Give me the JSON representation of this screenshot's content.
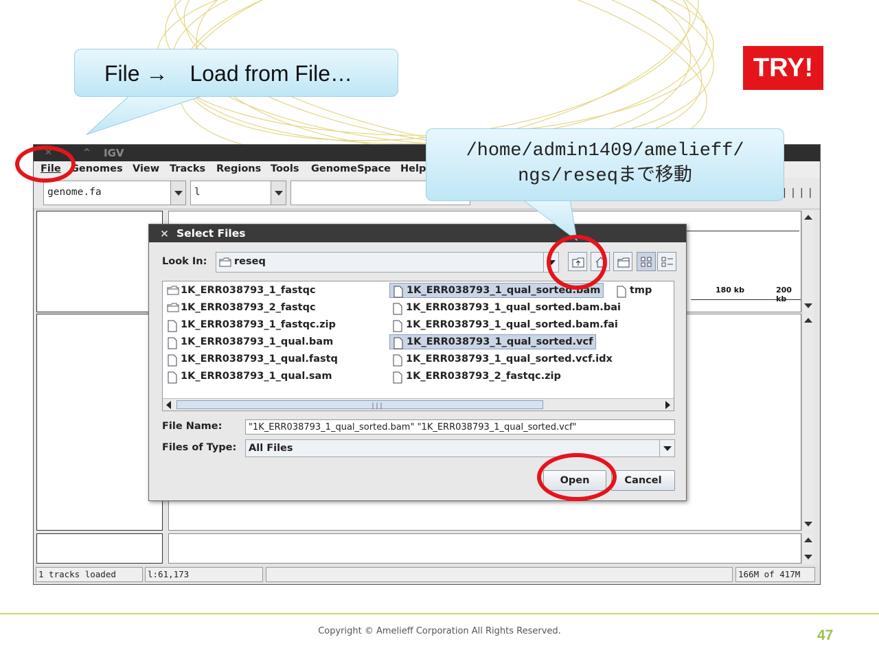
{
  "callout_top": {
    "text": "File →　Load from File…"
  },
  "callout_path": {
    "line1": "/home/admin1409/amelieff/",
    "line2": "ngs/reseqまで移動"
  },
  "badge": {
    "text": "TRY!"
  },
  "igv": {
    "title": "IGV",
    "menu": [
      "File",
      "Genomes",
      "View",
      "Tracks",
      "Regions",
      "Tools",
      "GenomeSpace",
      "Help"
    ],
    "genome_value": "genome.fa",
    "chrom_value": "l",
    "ruler_labels": [
      "180 kb",
      "200 kb"
    ],
    "status": {
      "tracks": "1 tracks loaded",
      "position": "l:61,173",
      "memory": "166M of 417M"
    }
  },
  "dialog": {
    "title": "Select Files",
    "look_in_label": "Look In:",
    "look_in_value": "reseq",
    "files": [
      {
        "name": "1K_ERR038793_1_fastqc",
        "kind": "folder",
        "selected": false
      },
      {
        "name": "1K_ERR038793_2_fastqc",
        "kind": "folder",
        "selected": false
      },
      {
        "name": "1K_ERR038793_1_fastqc.zip",
        "kind": "file",
        "selected": false
      },
      {
        "name": "1K_ERR038793_1_qual.bam",
        "kind": "file",
        "selected": false
      },
      {
        "name": "1K_ERR038793_1_qual.fastq",
        "kind": "file",
        "selected": false
      },
      {
        "name": "1K_ERR038793_1_qual.sam",
        "kind": "file",
        "selected": false
      },
      {
        "name": "1K_ERR038793_1_qual_sorted.bam",
        "kind": "file",
        "selected": true
      },
      {
        "name": "1K_ERR038793_1_qual_sorted.bam.bai",
        "kind": "file",
        "selected": false
      },
      {
        "name": "1K_ERR038793_1_qual_sorted.bam.fai",
        "kind": "file",
        "selected": false
      },
      {
        "name": "1K_ERR038793_1_qual_sorted.vcf",
        "kind": "file",
        "selected": true
      },
      {
        "name": "1K_ERR038793_1_qual_sorted.vcf.idx",
        "kind": "file",
        "selected": false
      },
      {
        "name": "1K_ERR038793_2_fastqc.zip",
        "kind": "file",
        "selected": false
      },
      {
        "name": "tmp",
        "kind": "file",
        "selected": false
      }
    ],
    "file_name_label": "File Name:",
    "file_name_value": "\"1K_ERR038793_1_qual_sorted.bam\" \"1K_ERR038793_1_qual_sorted.vcf\"",
    "files_of_type_label": "Files of Type:",
    "files_of_type_value": "All Files",
    "open_label": "Open",
    "cancel_label": "Cancel"
  },
  "footer": {
    "copyright": "Copyright © Amelieff Corporation All Rights Reserved.",
    "page": "47"
  },
  "colors": {
    "highlight_ring": "#e5141b",
    "callout_fill": "#c8eaf8",
    "accent_green": "#9cc24a",
    "selection": "#cad6e6"
  }
}
